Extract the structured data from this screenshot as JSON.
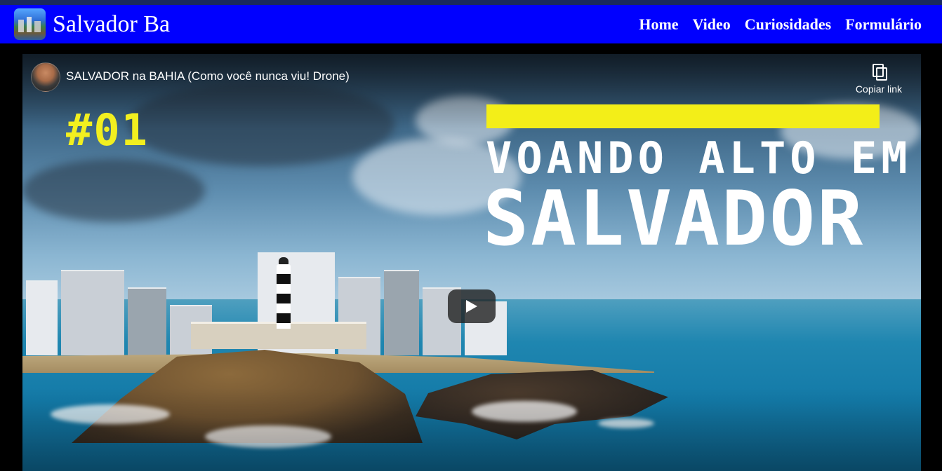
{
  "navbar": {
    "brand": "Salvador Ba",
    "links": [
      "Home",
      "Video",
      "Curiosidades",
      "Formulário"
    ]
  },
  "video": {
    "title": "SALVADOR na BAHIA (Como você nunca viu! Drone)",
    "copy_link_label": "Copiar link",
    "thumbnail": {
      "episode": "#01",
      "headline_line1": "VOANDO ALTO EM",
      "headline_line2": "SALVADOR"
    }
  },
  "colors": {
    "navbar_bg": "#0000ff",
    "accent_yellow": "#f3ee18"
  },
  "icons": {
    "copy": "copy-icon",
    "play": "play-icon"
  }
}
